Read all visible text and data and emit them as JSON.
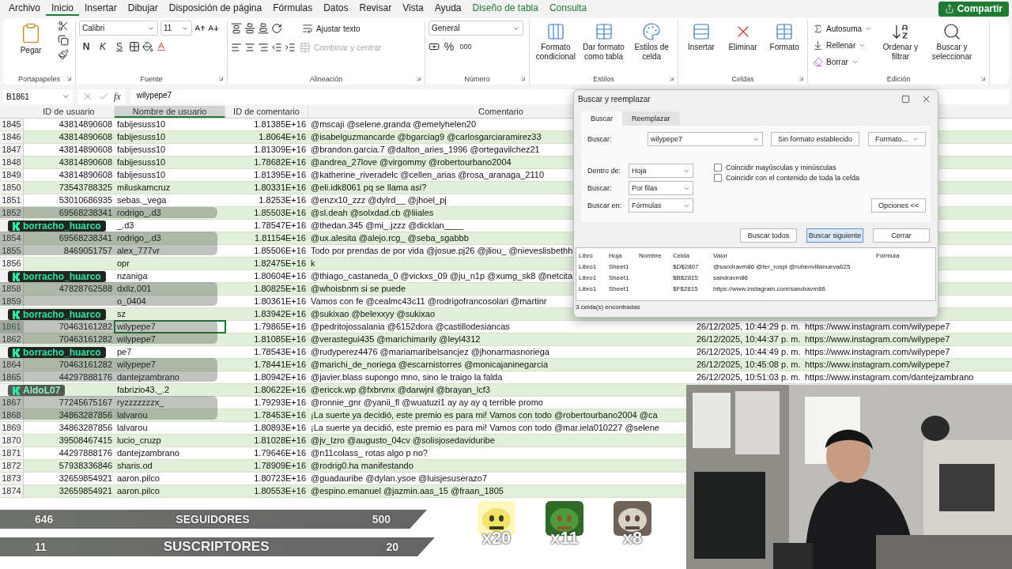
{
  "menu_tabs": [
    {
      "label": "Archivo",
      "selected": false,
      "contextual": false
    },
    {
      "label": "Inicio",
      "selected": true,
      "contextual": false
    },
    {
      "label": "Insertar",
      "selected": false,
      "contextual": false
    },
    {
      "label": "Dibujar",
      "selected": false,
      "contextual": false
    },
    {
      "label": "Disposición de página",
      "selected": false,
      "contextual": false
    },
    {
      "label": "Fórmulas",
      "selected": false,
      "contextual": false
    },
    {
      "label": "Datos",
      "selected": false,
      "contextual": false
    },
    {
      "label": "Revisar",
      "selected": false,
      "contextual": false
    },
    {
      "label": "Vista",
      "selected": false,
      "contextual": false
    },
    {
      "label": "Ayuda",
      "selected": false,
      "contextual": false
    },
    {
      "label": "Diseño de tabla",
      "selected": false,
      "contextual": true
    },
    {
      "label": "Consulta",
      "selected": false,
      "contextual": true
    }
  ],
  "share_button": "Compartir",
  "ribbon": {
    "clipboard": {
      "label": "Portapapeles",
      "paste": "Pegar"
    },
    "font": {
      "label": "Fuente",
      "family": "Calibri",
      "size": "11",
      "bold": "N",
      "italic": "K",
      "underline": "S"
    },
    "alignment": {
      "label": "Alineación",
      "wrap": "Ajustar texto",
      "merge": {
        "text": "Combinar y centrar",
        "disabled": true
      }
    },
    "number": {
      "label": "Número",
      "format": "General",
      "percent": "%",
      "thousands": "000"
    },
    "styles": {
      "label": "Estilos",
      "buttons": [
        "Formato condicional",
        "Dar formato como tabla",
        "Estilos de celda"
      ]
    },
    "cells": {
      "label": "Celdas",
      "buttons": [
        "Insertar",
        "Eliminar",
        "Formato"
      ]
    },
    "editing": {
      "label": "Edición",
      "small": [
        "Autosuma",
        "Rellenar",
        "Borrar"
      ],
      "big": [
        "Ordenar y filtrar",
        "Buscar y seleccionar"
      ]
    }
  },
  "formula_bar": {
    "name_box": "B1861",
    "fx": "fx",
    "value": "wilypepe7"
  },
  "columns": [
    {
      "label": "ID de usuario",
      "selected": false
    },
    {
      "label": "Nombre de usuario",
      "selected": true
    },
    {
      "label": "ID de comentario",
      "selected": false
    },
    {
      "label": "Comentario",
      "selected": false
    }
  ],
  "rows": [
    {
      "n": "1845",
      "user_id": "43814890608",
      "user": "fabijesuss10",
      "comment_id": "1.81385E+16",
      "comment": "@mscaji @selene.granda @emelyhelen20",
      "selected": false
    },
    {
      "n": "1846",
      "user_id": "43814890608",
      "user": "fabijesuss10",
      "comment_id": "1.8064E+16",
      "comment": "@isabelguzmancarde @bgarciag9 @carlosgarciaramirez33",
      "selected": false
    },
    {
      "n": "1847",
      "user_id": "43814890608",
      "user": "fabijesuss10",
      "comment_id": "1.81309E+16",
      "comment": "@brandon.garcia.7 @dalton_aries_1996 @ortegavilchez21",
      "selected": false
    },
    {
      "n": "1848",
      "user_id": "43814890608",
      "user": "fabijesuss10",
      "comment_id": "1.78682E+16",
      "comment": "@andrea_27love @virgommy @robertourbano2004",
      "selected": false
    },
    {
      "n": "1849",
      "user_id": "43814890608",
      "user": "fabijesuss10",
      "comment_id": "1.81395E+16",
      "comment": "@katherine_riveradelc @cellen_arias @rosa_aranaga_2110",
      "selected": false
    },
    {
      "n": "1850",
      "user_id": "73543788325",
      "user": "miluskamcruz",
      "comment_id": "1.80331E+16",
      "comment": "@eli.idk8061 pq se llama asi?",
      "selected": false
    },
    {
      "n": "1851",
      "user_id": "53010686935",
      "user": "sebas._vega",
      "comment_id": "1.8253E+16",
      "comment": "@enzx10_zzz @dylrd__ @jhoel_pj",
      "selected": false
    },
    {
      "n": "1852",
      "user_id": "69568238341",
      "user": "rodrigo_.d3",
      "comment_id": "1.85503E+16",
      "comment": "@sl.deah @solxdad.cb @liiales",
      "selected": false
    },
    {
      "user": "_.d3",
      "comment_id": "1.78547E+16",
      "comment": "@thedan.345 @mi_.jzzz @dicklan____",
      "selected": false
    },
    {
      "n": "1854",
      "user_id": "69568238341",
      "user": "rodrigo_.d3",
      "comment_id": "1.81154E+16",
      "comment": "@ux.alesita @alejo.rcg_ @seba_sgabbb",
      "selected": false
    },
    {
      "n": "1855",
      "user_id": "8469051757",
      "user": "alex_777vr",
      "comment_id": "1.85506E+16",
      "comment": "Todo por prendas de por vida @josue.pj26 @jliou_ @nieveslisbethh",
      "selected": false
    },
    {
      "n": "1856",
      "user": "opr",
      "comment_id": "1.82475E+16",
      "comment": "k",
      "selected": false
    },
    {
      "user": "nzaniga",
      "comment_id": "1.80604E+16",
      "comment": "@thiago_castaneda_0 @vickxs_09 @ju_n1p @xumg_sk8 @netcita",
      "selected": false
    },
    {
      "n": "1858",
      "user_id": "47828762588",
      "user": "dxllz.001",
      "comment_id": "1.80825E+16",
      "comment": "@whoisbnm si se puede",
      "selected": false
    },
    {
      "n": "1859",
      "user": "o_0404",
      "comment_id": "1.80361E+16",
      "comment": "Vamos con fe  @cealmc43c11 @rodrigofrancosolari @martinr",
      "selected": false
    },
    {
      "user": "sz",
      "comment_id": "1.83942E+16",
      "comment": "@sukixao @belexxyy @sukixao",
      "selected": false
    },
    {
      "n": "1861",
      "user_id": "70463161282",
      "user": "wilypepe7",
      "comment_id": "1.79865E+16",
      "comment": "@pedritojossalania @6152dora @castillodesiancas",
      "date": "26/12/2025, 10:44:29 p. m.",
      "url": "https://www.instagram.com/wilypepe7",
      "selected": true
    },
    {
      "n": "1862",
      "user_id": "70463161282",
      "user": "wilypepe7",
      "comment_id": "1.81085E+16",
      "comment": "@verastegui435 @marichimarily @leyl4312",
      "date": "26/12/2025, 10:44:37 p. m.",
      "url": "https://www.instagram.com/wilypepe7",
      "selected": false
    },
    {
      "user": "pe7",
      "comment_id": "1.78543E+16",
      "comment": "@rudyperez4476 @mariamaribelsancjez  @jhonarmasnoriega",
      "date": "26/12/2025, 10:44:49 p. m.",
      "url": "https://www.instagram.com/wilypepe7",
      "selected": false
    },
    {
      "n": "1864",
      "user_id": "70463161282",
      "user": "wilypepe7",
      "comment_id": "1.78441E+16",
      "comment": "@marichi_de_noriega @escarnistorres @monicajaninegarcia",
      "date": "26/12/2025, 10:45:08 p. m.",
      "url": "https://www.instagram.com/wilypepe7",
      "selected": false
    },
    {
      "n": "1865",
      "user_id": "44297888176",
      "user": "dantejzambrano",
      "comment_id": "1.80942E+16",
      "comment": "@javier.blass supongo mno, sino le traigo la falda",
      "date": "26/12/2025, 10:51:03 p. m.",
      "url": "https://www.instagram.com/dantejzambrano",
      "selected": false
    },
    {
      "user": "fabrizio43._.2",
      "comment_id": "1.80622E+16",
      "comment": "@ericck.wp @fxbrvnx @darwjnl @brayan_lcf3",
      "selected": false
    },
    {
      "n": "1867",
      "user_id": "77245675167",
      "user": "ryzzzzzzzx_",
      "comment_id": "1.79293E+16",
      "comment": "@ronnie_gnr @yanii_fl @wuatuzi1 ay ay ay q terrible promo",
      "selected": false
    },
    {
      "n": "1868",
      "user_id": "34863287856",
      "user": "lalvarou",
      "comment_id": "1.78453E+16",
      "comment": "¡La suerte ya decidió, este premio es para mi!  Vamos con todo @robertourbano2004 @ca",
      "selected": false
    },
    {
      "n": "1869",
      "user_id": "34863287856",
      "user": "lalvarou",
      "comment_id": "1.80893E+16",
      "comment": "¡La suerte ya decidió, este premio es para mi!  Vamos con todo @mar.iela010227 @selene",
      "selected": false
    },
    {
      "n": "1870",
      "user_id": "39508467415",
      "user": "lucio_cruzp",
      "comment_id": "1.81028E+16",
      "comment": "@jv_lzro @augusto_04cv @solisjosedaviduribe",
      "selected": false
    },
    {
      "n": "1871",
      "user_id": "44297888176",
      "user": "dantejzambrano",
      "comment_id": "1.79646E+16",
      "comment": "@n11colass_ rotas algo p no?",
      "selected": false
    },
    {
      "n": "1872",
      "user_id": "57938336846",
      "user": "sharis.od",
      "comment_id": "1.78909E+16",
      "comment": "@rodrig0.ha manifestando",
      "selected": false
    },
    {
      "n": "1873",
      "user_id": "32659854921",
      "user": "aaron.pilco",
      "comment_id": "1.80723E+16",
      "comment": "@guadauribe @dylan.ysoe @luisjesuserazo7",
      "selected": false
    },
    {
      "n": "1874",
      "user_id": "32659854921",
      "user": "aaron.pilco",
      "comment_id": "1.80553E+16",
      "comment": "@espino.emanuel @jazmin.aas_15 @fraan_1805",
      "selected": false
    }
  ],
  "dialog": {
    "title": "Buscar y reemplazar",
    "tabs": [
      {
        "label": "Buscar",
        "selected": true
      },
      {
        "label": "Reemplazar",
        "selected": false
      }
    ],
    "find_label": "Buscar:",
    "find_value": "wilypepe7",
    "no_format": "Sin formato establecido",
    "format": "Formato...",
    "selects": [
      {
        "label": "Dentro de:",
        "value": "Hoja"
      },
      {
        "label": "Buscar:",
        "value": "Por filas"
      },
      {
        "label": "Buscar en:",
        "value": "Fórmulas"
      }
    ],
    "checkboxes": [
      {
        "label": "Coincidir mayúsculas y minúsculas",
        "checked": false
      },
      {
        "label": "Coincidir con el contenido de toda la celda",
        "checked": false
      }
    ],
    "options": "Opciones <<",
    "buttons": [
      {
        "label": "Buscar todos",
        "focused": false
      },
      {
        "label": "Buscar siguiente",
        "focused": true
      },
      {
        "label": "Cerrar",
        "focused": false
      }
    ],
    "results_columns": [
      "Libro",
      "Hoja",
      "Nombre",
      "Celda",
      "Valor",
      "Fórmula"
    ],
    "results": [
      {
        "book": "Libro1",
        "sheet": "Sheet1",
        "cell": "$D$2807",
        "value": "@sandravm86 @fer_rospi @rubenvillanueva625"
      },
      {
        "book": "Libro1",
        "sheet": "Sheet1",
        "cell": "$B$2815",
        "value": "sandravm86"
      },
      {
        "book": "Libro1",
        "sheet": "Sheet1",
        "cell": "$F$2815",
        "value": "https://www.instagram.com/sandravm86"
      }
    ],
    "status": "3 celda(s) encontradas"
  },
  "chat": [
    {
      "user": "borracho_huarco",
      "faded": false
    },
    {
      "user": "borracho_huarco",
      "faded": false
    },
    {
      "user": "borracho_huarco",
      "faded": false
    },
    {
      "user": "borracho_huarco",
      "faded": false
    },
    {
      "user": "AldoL07",
      "faded": true
    }
  ],
  "stream_bars": [
    {
      "current": "646",
      "label": "SEGUIDORES",
      "goal": "500"
    },
    {
      "current": "11",
      "label": "SUSCRIPTORES",
      "goal": "20"
    }
  ],
  "emotes": [
    {
      "count": "x20"
    },
    {
      "count": "x11"
    },
    {
      "count": "x8"
    }
  ]
}
